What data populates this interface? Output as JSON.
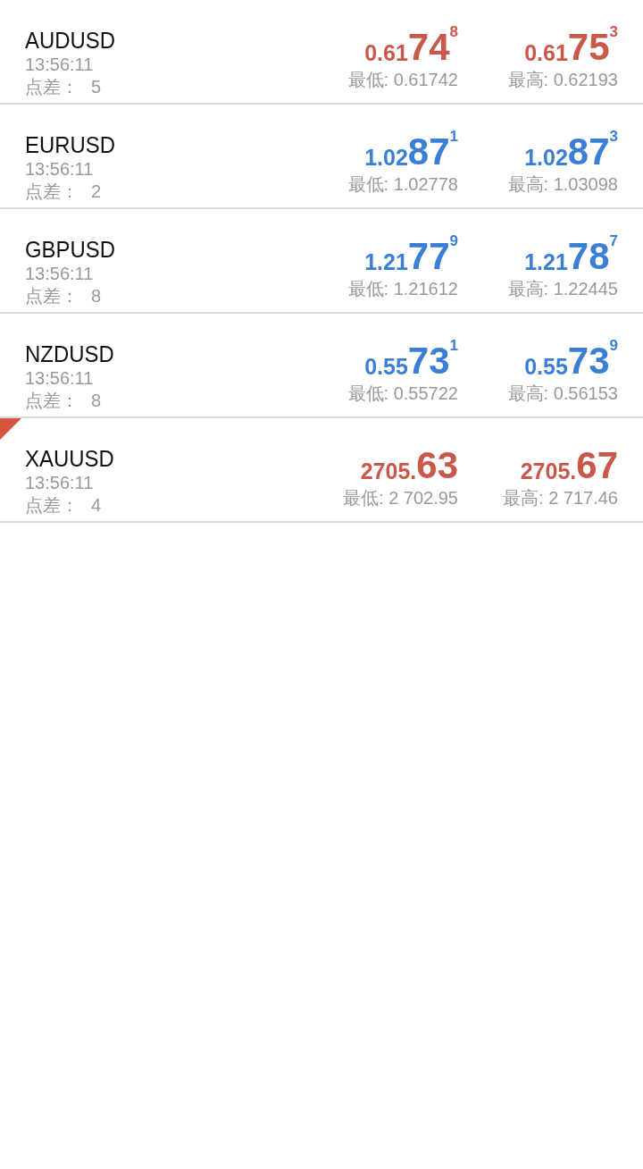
{
  "quotes": [
    {
      "symbol": "AUDUSD",
      "time": "13:56:11",
      "spread_label": "点差：",
      "spread": "5",
      "flagged": false,
      "color": "#c9574a",
      "bid": {
        "prefix": "0.61",
        "main": "74",
        "sup": "8"
      },
      "ask": {
        "prefix": "0.61",
        "main": "75",
        "sup": "3"
      },
      "low": "最低: 0.61742",
      "high": "最高: 0.62193"
    },
    {
      "symbol": "EURUSD",
      "time": "13:56:11",
      "spread_label": "点差：",
      "spread": "2",
      "flagged": false,
      "color": "#3a7fd5",
      "bid": {
        "prefix": "1.02",
        "main": "87",
        "sup": "1"
      },
      "ask": {
        "prefix": "1.02",
        "main": "87",
        "sup": "3"
      },
      "low": "最低: 1.02778",
      "high": "最高: 1.03098"
    },
    {
      "symbol": "GBPUSD",
      "time": "13:56:11",
      "spread_label": "点差：",
      "spread": "8",
      "flagged": false,
      "color": "#3a7fd5",
      "bid": {
        "prefix": "1.21",
        "main": "77",
        "sup": "9"
      },
      "ask": {
        "prefix": "1.21",
        "main": "78",
        "sup": "7"
      },
      "low": "最低: 1.21612",
      "high": "最高: 1.22445"
    },
    {
      "symbol": "NZDUSD",
      "time": "13:56:11",
      "spread_label": "点差：",
      "spread": "8",
      "flagged": false,
      "color": "#3a7fd5",
      "bid": {
        "prefix": "0.55",
        "main": "73",
        "sup": "1"
      },
      "ask": {
        "prefix": "0.55",
        "main": "73",
        "sup": "9"
      },
      "low": "最低: 0.55722",
      "high": "最高: 0.56153"
    },
    {
      "symbol": "XAUUSD",
      "time": "13:56:11",
      "spread_label": "点差：",
      "spread": "4",
      "flagged": true,
      "color": "#c9574a",
      "bid": {
        "prefix": "2705.",
        "main": "63"
      },
      "ask": {
        "prefix": "2705.",
        "main": "67"
      },
      "low": "最低: 2 702.95",
      "high": "最高: 2 717.46"
    }
  ]
}
